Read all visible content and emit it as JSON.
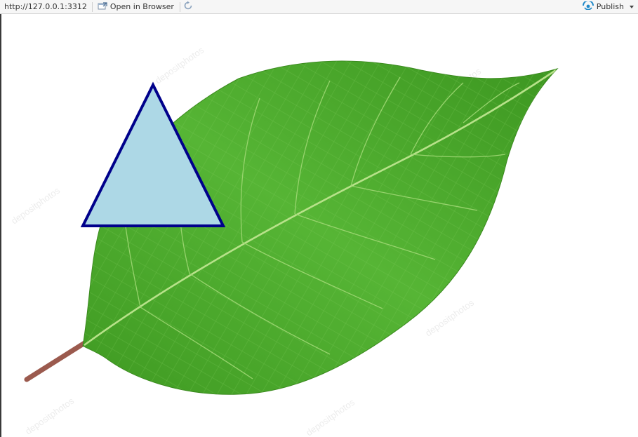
{
  "toolbar": {
    "url": "http://127.0.0.1:3312",
    "open_in_browser_label": "Open in Browser",
    "publish_label": "Publish"
  },
  "watermark_text": "depositphotos",
  "colors": {
    "toolbar_bg": "#f6f6f6",
    "publish_icon": "#1e88c8",
    "leaf_green": "#4caa2c",
    "leaf_dark": "#2f7f1c",
    "stem": "#9b5a4e",
    "triangle_fill": "#add8e6",
    "triangle_stroke": "#00008b"
  }
}
